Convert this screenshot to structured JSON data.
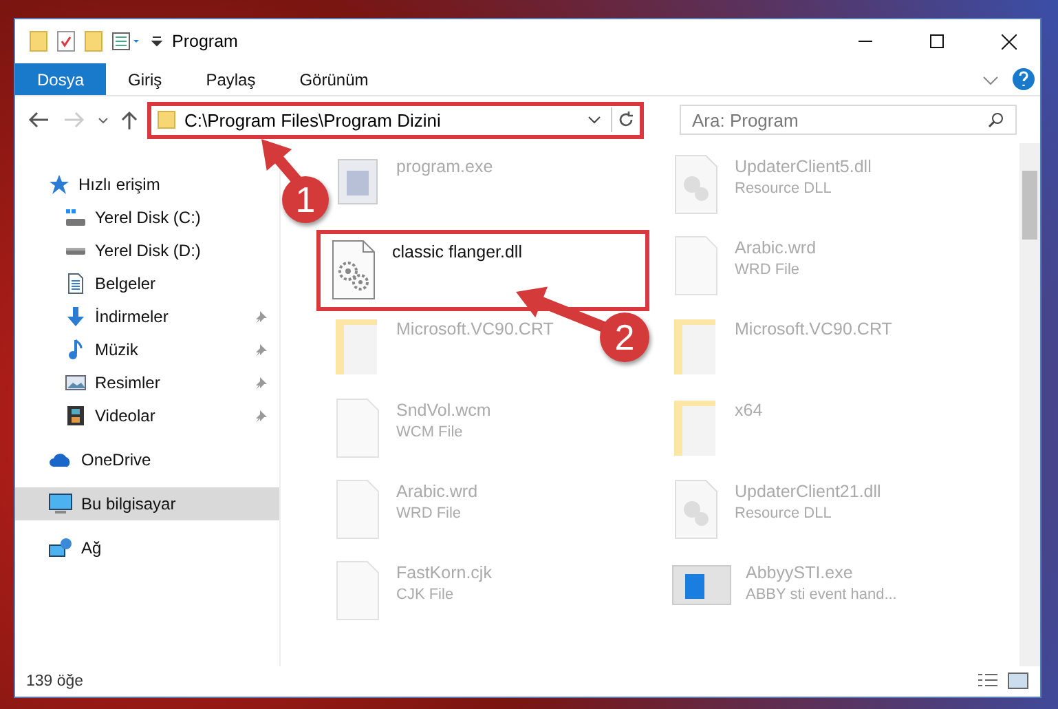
{
  "window": {
    "title": "Program"
  },
  "ribbon_tabs": [
    {
      "label": "Dosya",
      "selected": true
    },
    {
      "label": "Giriş",
      "selected": false
    },
    {
      "label": "Paylaş",
      "selected": false
    },
    {
      "label": "Görünüm",
      "selected": false
    }
  ],
  "address": {
    "path": "C:\\Program Files\\Program Dizini",
    "highlighted": true
  },
  "search": {
    "placeholder": "Ara: Program"
  },
  "sidebar": {
    "items": [
      {
        "label": "Hızlı erişim",
        "kind": "star",
        "selected": false,
        "children": [
          {
            "label": "Yerel Disk (C:)",
            "kind": "windisk",
            "pinned": false,
            "selected": false
          },
          {
            "label": "Yerel Disk (D:)",
            "kind": "disk",
            "pinned": false,
            "selected": false
          },
          {
            "label": "Belgeler",
            "kind": "document",
            "pinned": false,
            "selected": false
          },
          {
            "label": "İndirmeler",
            "kind": "download",
            "pinned": true,
            "selected": false
          },
          {
            "label": "Müzik",
            "kind": "music",
            "pinned": true,
            "selected": false
          },
          {
            "label": "Resimler",
            "kind": "picture",
            "pinned": true,
            "selected": false
          },
          {
            "label": "Videolar",
            "kind": "film",
            "pinned": true,
            "selected": false
          }
        ]
      },
      {
        "label": "OneDrive",
        "kind": "cloud",
        "selected": false
      },
      {
        "label": "Bu bilgisayar",
        "kind": "computer",
        "selected": true
      },
      {
        "label": "Ağ",
        "kind": "network",
        "selected": false
      }
    ]
  },
  "files": [
    {
      "name": "program.exe",
      "kind": "app",
      "highlighted": false
    },
    {
      "name": "UpdaterClient5.dll",
      "type": "Resource DLL",
      "kind": "dll",
      "highlighted": false
    },
    {
      "name": "classic flanger.dll",
      "kind": "gears",
      "highlighted": true
    },
    {
      "name": "Arabic.wrd",
      "type": "WRD File",
      "kind": "blank",
      "highlighted": false
    },
    {
      "name": "Microsoft.VC90.CRT",
      "kind": "folder",
      "highlighted": false
    },
    {
      "name": "Microsoft.VC90.CRT",
      "kind": "folder",
      "highlighted": false
    },
    {
      "name": "SndVol.wcm",
      "type": "WCM File",
      "kind": "blank",
      "highlighted": false
    },
    {
      "name": "x64",
      "kind": "folder",
      "highlighted": false
    },
    {
      "name": "Arabic.wrd",
      "type": "WRD File",
      "kind": "blank",
      "highlighted": false
    },
    {
      "name": "UpdaterClient21.dll",
      "type": "Resource DLL",
      "kind": "dll",
      "highlighted": false
    },
    {
      "name": "FastKorn.cjk",
      "type": "CJK File",
      "kind": "blank",
      "highlighted": false
    },
    {
      "name": "AbbyySTI.exe",
      "type": "ABBY sti event hand...",
      "kind": "window",
      "highlighted": false
    }
  ],
  "status_bar": {
    "count": "139 öğe"
  },
  "annotations": [
    {
      "label": "1"
    },
    {
      "label": "2"
    }
  ]
}
